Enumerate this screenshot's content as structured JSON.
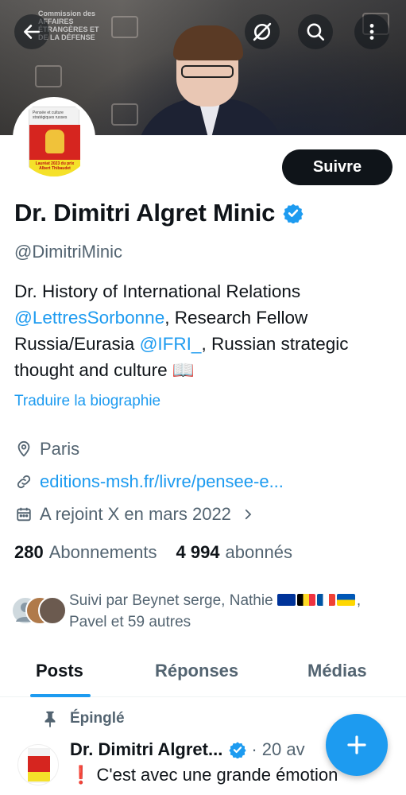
{
  "banner": {
    "org_text": "Commission des AFFAIRES ÉTRANGÈRES ET DE LA DÉFENSE"
  },
  "actions": {
    "back_icon": "arrow-left-icon",
    "grok_icon": "slash-circle-icon",
    "search_icon": "search-icon",
    "more_icon": "more-vertical-icon"
  },
  "avatar": {
    "book_title": "Pensée et culture stratégiques russes",
    "award": "Lauréat 2023 du prix Albert Thibaudet"
  },
  "follow_button": "Suivre",
  "profile": {
    "name": "Dr. Dimitri Algret Minic",
    "handle": "@DimitriMinic",
    "bio": {
      "line1": "Dr. History of International Relations",
      "mention1": "@LettresSorbonne",
      "line2_rest": ", Research Fellow",
      "line3_start": "Russia/Eurasia ",
      "mention2": "@IFRI_",
      "line3_rest": ", Russian strategic",
      "line4": "thought and culture 📖"
    },
    "translate": "Traduire la biographie",
    "location": "Paris",
    "website": "editions-msh.fr/livre/pensee-e...",
    "joined": "A rejoint X en mars 2022"
  },
  "stats": {
    "following_count": "280",
    "following_label": "Abonnements",
    "followers_count": "4 994",
    "followers_label": "abonnés"
  },
  "followed_by": {
    "text_start": "Suivi par Beynet serge, Nathie ",
    "text_end": ",",
    "line2": "Pavel et 59 autres"
  },
  "tabs": [
    {
      "label": "Posts"
    },
    {
      "label": "Réponses"
    },
    {
      "label": "Médias"
    }
  ],
  "pinned_post": {
    "pinned_label": "Épinglé",
    "author": "Dr. Dimitri Algret...",
    "time": "· 20 av",
    "text": "❗ C'est avec une grande émotion"
  },
  "colors": {
    "accent": "#1d9bf0",
    "text": "#0f1419",
    "secondary": "#536471"
  }
}
